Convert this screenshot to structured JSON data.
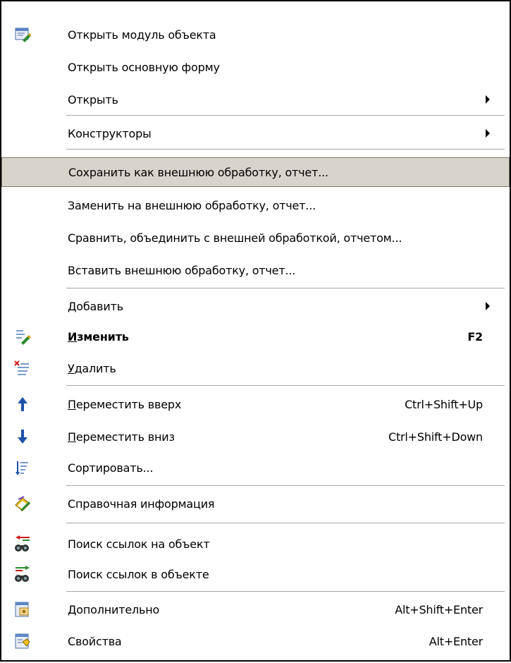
{
  "menu": {
    "items": [
      {
        "label": "Открыть модуль объекта",
        "icon": "module-icon"
      },
      {
        "label": "Открыть основную форму"
      },
      {
        "label": "Открыть",
        "submenu": true
      },
      {
        "label": "Конструкторы",
        "submenu": true
      },
      {
        "label": "Сохранить как внешнюю обработку, отчет...",
        "selected": true
      },
      {
        "label": "Заменить на внешнюю обработку, отчет..."
      },
      {
        "label": "Сравнить, объединить с внешней обработкой, отчетом..."
      },
      {
        "label": "Вставить внешнюю обработку, отчет..."
      },
      {
        "label": "Добавить",
        "submenu": true
      },
      {
        "label_mnemonic": "И",
        "label_rest": "зменить",
        "shortcut": "F2",
        "bold": true,
        "icon": "edit-icon"
      },
      {
        "label_mnemonic": "У",
        "label_rest": "далить",
        "icon": "delete-icon"
      },
      {
        "label_mnemonic": "П",
        "label_rest": "ереместить вверх",
        "shortcut": "Ctrl+Shift+Up",
        "icon": "arrow-up-icon"
      },
      {
        "label_mnemonic": "П",
        "label_rest": "ереместить вниз",
        "shortcut": "Ctrl+Shift+Down",
        "icon": "arrow-down-icon"
      },
      {
        "label": "Сортировать...",
        "icon": "sort-icon"
      },
      {
        "label": "Справочная информация",
        "icon": "help-book-icon"
      },
      {
        "label": "Поиск ссылок на объект",
        "icon": "binoculars-refs-icon"
      },
      {
        "label": "Поиск ссылок в объекте",
        "icon": "binoculars-in-object-icon"
      },
      {
        "label": "Дополнительно",
        "shortcut": "Alt+Shift+Enter",
        "icon": "additional-icon"
      },
      {
        "label": "Свойства",
        "shortcut": "Alt+Enter",
        "icon": "properties-icon"
      }
    ]
  },
  "colors": {
    "selected_bg": "#d8d4cb",
    "selected_border": "#7c7665",
    "separator": "#a8a8a8",
    "arrow_blue": "#1f4fa8"
  }
}
